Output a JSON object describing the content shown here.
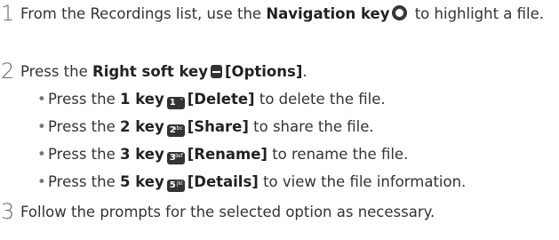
{
  "steps": [
    {
      "num": "1",
      "pre": "From the Recordings list, use the ",
      "bold": "Navigation key",
      "post": " to highlight a file."
    },
    {
      "num": "2",
      "pre": "Press the ",
      "bold": "Right soft key",
      "bold2": "[Options]",
      "post": "."
    },
    {
      "num": "3",
      "text": "Follow the prompts for the selected option as necessary."
    }
  ],
  "bullets": [
    {
      "bullet": "•",
      "pre": "Press the ",
      "key": "1 key",
      "key_icon": "1",
      "key_icon_sub": "°",
      "action": "[Delete]",
      "post": " to delete the file."
    },
    {
      "bullet": "•",
      "pre": "Press the ",
      "key": "2 key",
      "key_icon": "2",
      "key_icon_sub": "abc",
      "action": "[Share]",
      "post": " to share the file."
    },
    {
      "bullet": "•",
      "pre": "Press the ",
      "key": "3 key",
      "key_icon": "3",
      "key_icon_sub": "def",
      "action": "[Rename]",
      "post": " to rename the file."
    },
    {
      "bullet": "•",
      "pre": "Press the ",
      "key": "5 key",
      "key_icon": "5",
      "key_icon_sub": "jkl",
      "action": "[Details]",
      "post": " to view the file information."
    }
  ],
  "icons": {
    "navigation": "navigation-key-icon",
    "soft_key": "right-soft-key-icon"
  }
}
